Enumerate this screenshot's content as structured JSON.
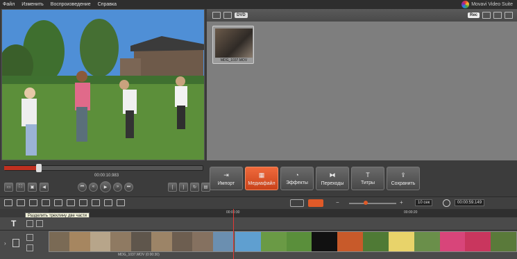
{
  "menu": {
    "items": [
      "Файл",
      "Изменить",
      "Воспроизведение",
      "Справка"
    ]
  },
  "brand": {
    "name": "Movavi Video Suite"
  },
  "toolbar": {
    "dvd": "DVD",
    "rec": "Rec"
  },
  "media": {
    "clip_name": "MDG_1037.MOV"
  },
  "player": {
    "time": "00:00:10.983"
  },
  "tools": [
    {
      "label": "Импорт",
      "icon": "import-icon"
    },
    {
      "label": "Медиафайл",
      "icon": "media-icon"
    },
    {
      "label": "Эффекты",
      "icon": "effects-icon"
    },
    {
      "label": "Переходы",
      "icon": "transitions-icon"
    },
    {
      "label": "Титры",
      "icon": "titles-icon"
    },
    {
      "label": "Сохранить",
      "icon": "save-icon"
    }
  ],
  "timeline": {
    "zoom": "10 сек",
    "total_time": "00:00:59.149",
    "tooltip": "Разделить трехлину две части",
    "ruler": [
      "00:00:30",
      "00:00:20"
    ],
    "clip_label": "MDG_1037.MOV (0:00:30)"
  },
  "colors": {
    "accent": "#e05a28",
    "playhead": "#e53935"
  }
}
